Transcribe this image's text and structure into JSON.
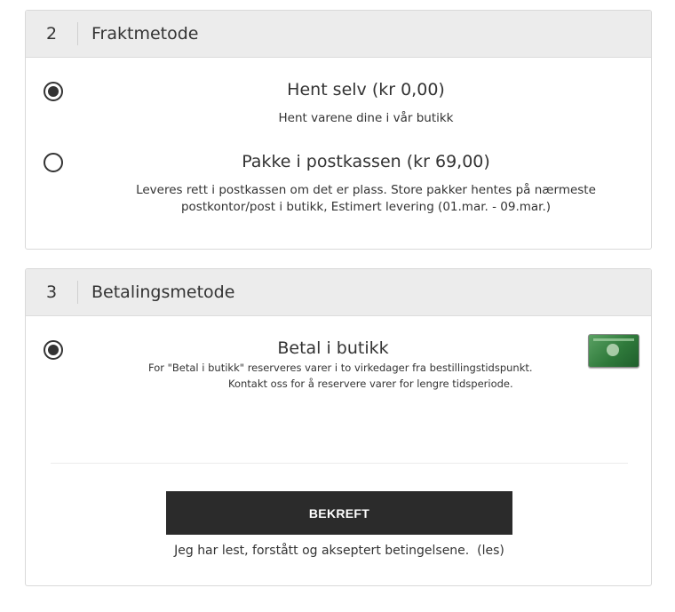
{
  "shipping": {
    "number": "2",
    "title": "Fraktmetode",
    "options": [
      {
        "title": "Hent selv (kr 0,00)",
        "desc": "Hent varene dine i vår butikk",
        "selected": true
      },
      {
        "title": "Pakke i postkassen (kr 69,00)",
        "desc_line1": "Leveres rett i postkassen om det er plass. Store pakker hentes på nærmeste",
        "desc_line2": "postkontor/post i butikk, Estimert levering (01.mar. - 09.mar.)",
        "selected": false
      }
    ]
  },
  "payment": {
    "number": "3",
    "title": "Betalingsmetode",
    "option": {
      "title": "Betal i butikk",
      "desc_line1": "For \"Betal i butikk\" reserveres varer i to virkedager fra bestillingstidspunkt.",
      "desc_line2": "Kontakt oss for å reservere varer for lengre tidsperiode.",
      "icon": "green-credit-card-icon",
      "selected": true
    },
    "confirm_label": "BEKREFT",
    "terms_text": "Jeg har lest, forstått og akseptert betingelsene.",
    "terms_link": "(les)"
  }
}
